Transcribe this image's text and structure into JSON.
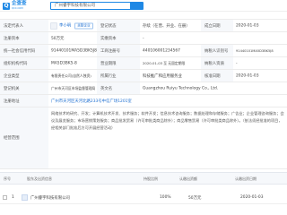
{
  "header": {
    "logo_cn": "企查查",
    "logo_en": "QCC.COM",
    "search_value": "广州睿宇科技有限公司"
  },
  "info": {
    "legal_rep_label": "法定代表人",
    "legal_rep_value": "李小明",
    "legal_rep_tag": "关联企业",
    "status_label": "登记状态",
    "status_value": "存续（在营、开业、在册）",
    "est_date_label": "成立日期",
    "est_date_value": "2020-01-03",
    "reg_capital_label": "注册资本",
    "reg_capital_value": "50万元",
    "paid_capital_label": "实缴资本",
    "paid_capital_value": "-",
    "credit_code_label": "统一社会信用代码",
    "credit_code_value": "91440101MA5D3BK5J8",
    "reg_no_label": "工商注册号",
    "reg_no_value": "440106001234567",
    "taxpayer_label": "纳税人识别号",
    "taxpayer_value": "91440101MA5D3BK5J8",
    "org_code_label": "组织机构代码",
    "org_code_value": "MA5D3BK5-8",
    "term_label": "营业期限",
    "term_value": "2020-01-03 至 无固定期限",
    "taxpayer_qual_label": "纳税人资质",
    "taxpayer_qual_value": "-",
    "type_label": "企业类型",
    "type_value": "有限责任公司(自然人独资)",
    "industry_label": "所属行业",
    "industry_value": "科技推广和应用服务业",
    "approve_label": "核准日期",
    "approve_value": "2020-01-03",
    "authority_label": "登记机关",
    "authority_value": "广州市天河区市场监督管理局",
    "en_name_label": "英文名",
    "en_name_value": "Guangzhou Ruiyu Technology Co., Ltd.",
    "address_label": "注册地址",
    "address_value": "广州市天河区天河北路233号中信广场1201室",
    "scope_label": "经营范围",
    "scope_value": "网络技术的研究、开发；计算机技术开发、技术服务；软件开发；信息技术咨询服务；数据处理和存储服务；广告业；企业管理咨询服务；会议及展览服务；市场营销策划服务；商品批发贸易（许可审批类商品除外）；商品零售贸易（许可审批类商品除外）。（依法须经批准的项目，经相关部门批准后方可开展经营活动）"
  },
  "shareholders": {
    "columns": [
      "序号",
      "股东及出资信息",
      "持股比例",
      "认缴出资额",
      "认缴出资日期"
    ],
    "rows": [
      {
        "index": "1",
        "name": "广州睿宇科技有限公司",
        "ratio": "100%",
        "amount": "50万元",
        "date": "2020-01-03"
      }
    ]
  }
}
